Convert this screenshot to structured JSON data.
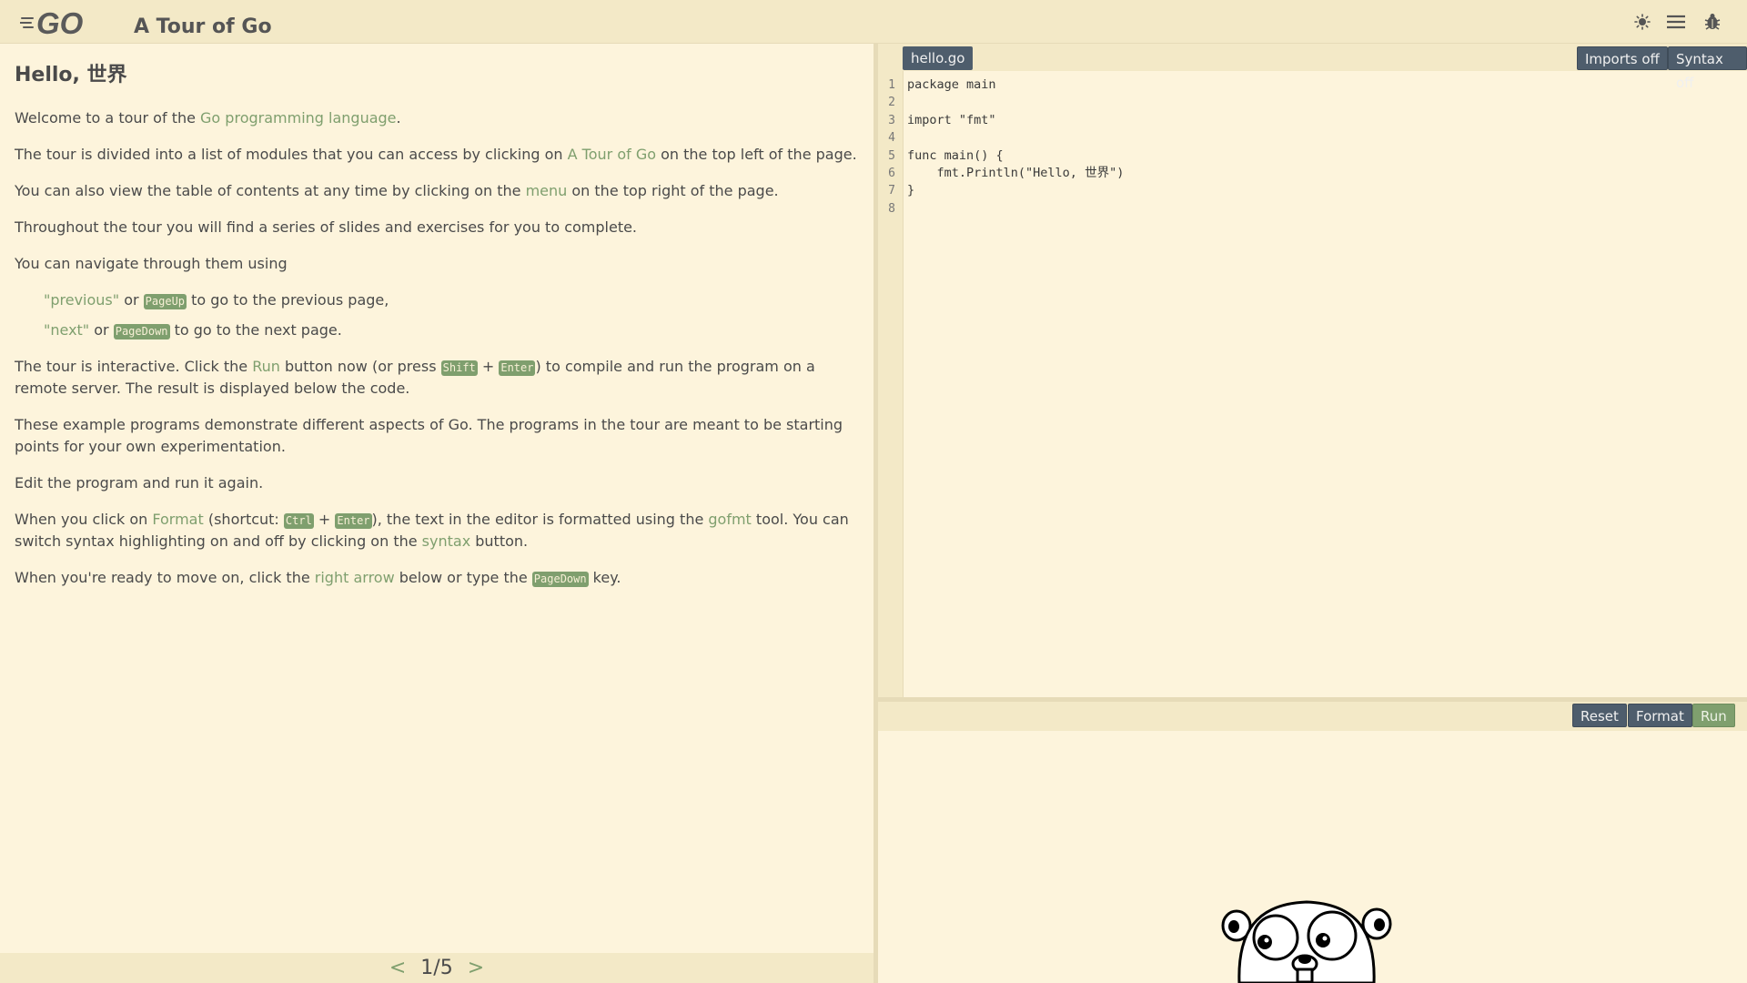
{
  "header": {
    "logo_text": "GO",
    "title": "A Tour of Go",
    "icons": [
      "theme-toggle-icon",
      "menu-icon",
      "bug-icon"
    ]
  },
  "content": {
    "heading": "Hello, 世界",
    "p1": {
      "before": "Welcome to a tour of the ",
      "link": "Go programming language",
      "after": "."
    },
    "p2": {
      "before": "The tour is divided into a list of modules that you can access by clicking on ",
      "link": "A Tour of Go",
      "after": " on the top left of the page."
    },
    "p3": {
      "before": "You can also view the table of contents at any time by clicking on the ",
      "link": "menu",
      "after": " on the top right of the page."
    },
    "p4": "Throughout the tour you will find a series of slides and exercises for you to complete.",
    "p5": "You can navigate through them using",
    "nav_prev": {
      "link": "\"previous\"",
      "or": " or ",
      "key": "PageUp",
      "after": " to go to the previous page,"
    },
    "nav_next": {
      "link": "\"next\"",
      "or": " or ",
      "key": "PageDown",
      "after": " to go to the next page."
    },
    "p6": {
      "before": "The tour is interactive. Click the ",
      "link": "Run",
      "mid": " button now (or press ",
      "key1": "Shift",
      "plus": " + ",
      "key2": "Enter",
      "after": ") to compile and run the program on a remote server. The result is displayed below the code."
    },
    "p7": "These example programs demonstrate different aspects of Go. The programs in the tour are meant to be starting points for your own experimentation.",
    "p8": "Edit the program and run it again.",
    "p9": {
      "before": "When you click on ",
      "link1": "Format",
      "mid1": " (shortcut: ",
      "key1": "Ctrl",
      "plus": " + ",
      "key2": "Enter",
      "mid2": "), the text in the editor is formatted using the ",
      "link2": "gofmt",
      "mid3": " tool. You can switch syntax highlighting on and off by clicking on the ",
      "link3": "syntax",
      "after": " button."
    },
    "p10": {
      "before": "When you're ready to move on, click the ",
      "link": "right arrow",
      "mid": " below or type the ",
      "key": "PageDown",
      "after": " key."
    }
  },
  "pager": {
    "prev": "<",
    "page": "1/5",
    "next": ">"
  },
  "editor": {
    "tab": "hello.go",
    "imports_btn": "Imports off",
    "syntax_btn": "Syntax off",
    "line_numbers": "1\n2\n3\n4\n5\n6\n7\n8",
    "code": "package main\n\nimport \"fmt\"\n\nfunc main() {\n    fmt.Println(\"Hello, 世界\")\n}\n",
    "reset_btn": "Reset",
    "format_btn": "Format",
    "run_btn": "Run"
  },
  "colors": {
    "background": "#fdf4dc",
    "header": "#f3e9c7",
    "accent": "#7f9f6e",
    "button": "#4e5d6c"
  }
}
